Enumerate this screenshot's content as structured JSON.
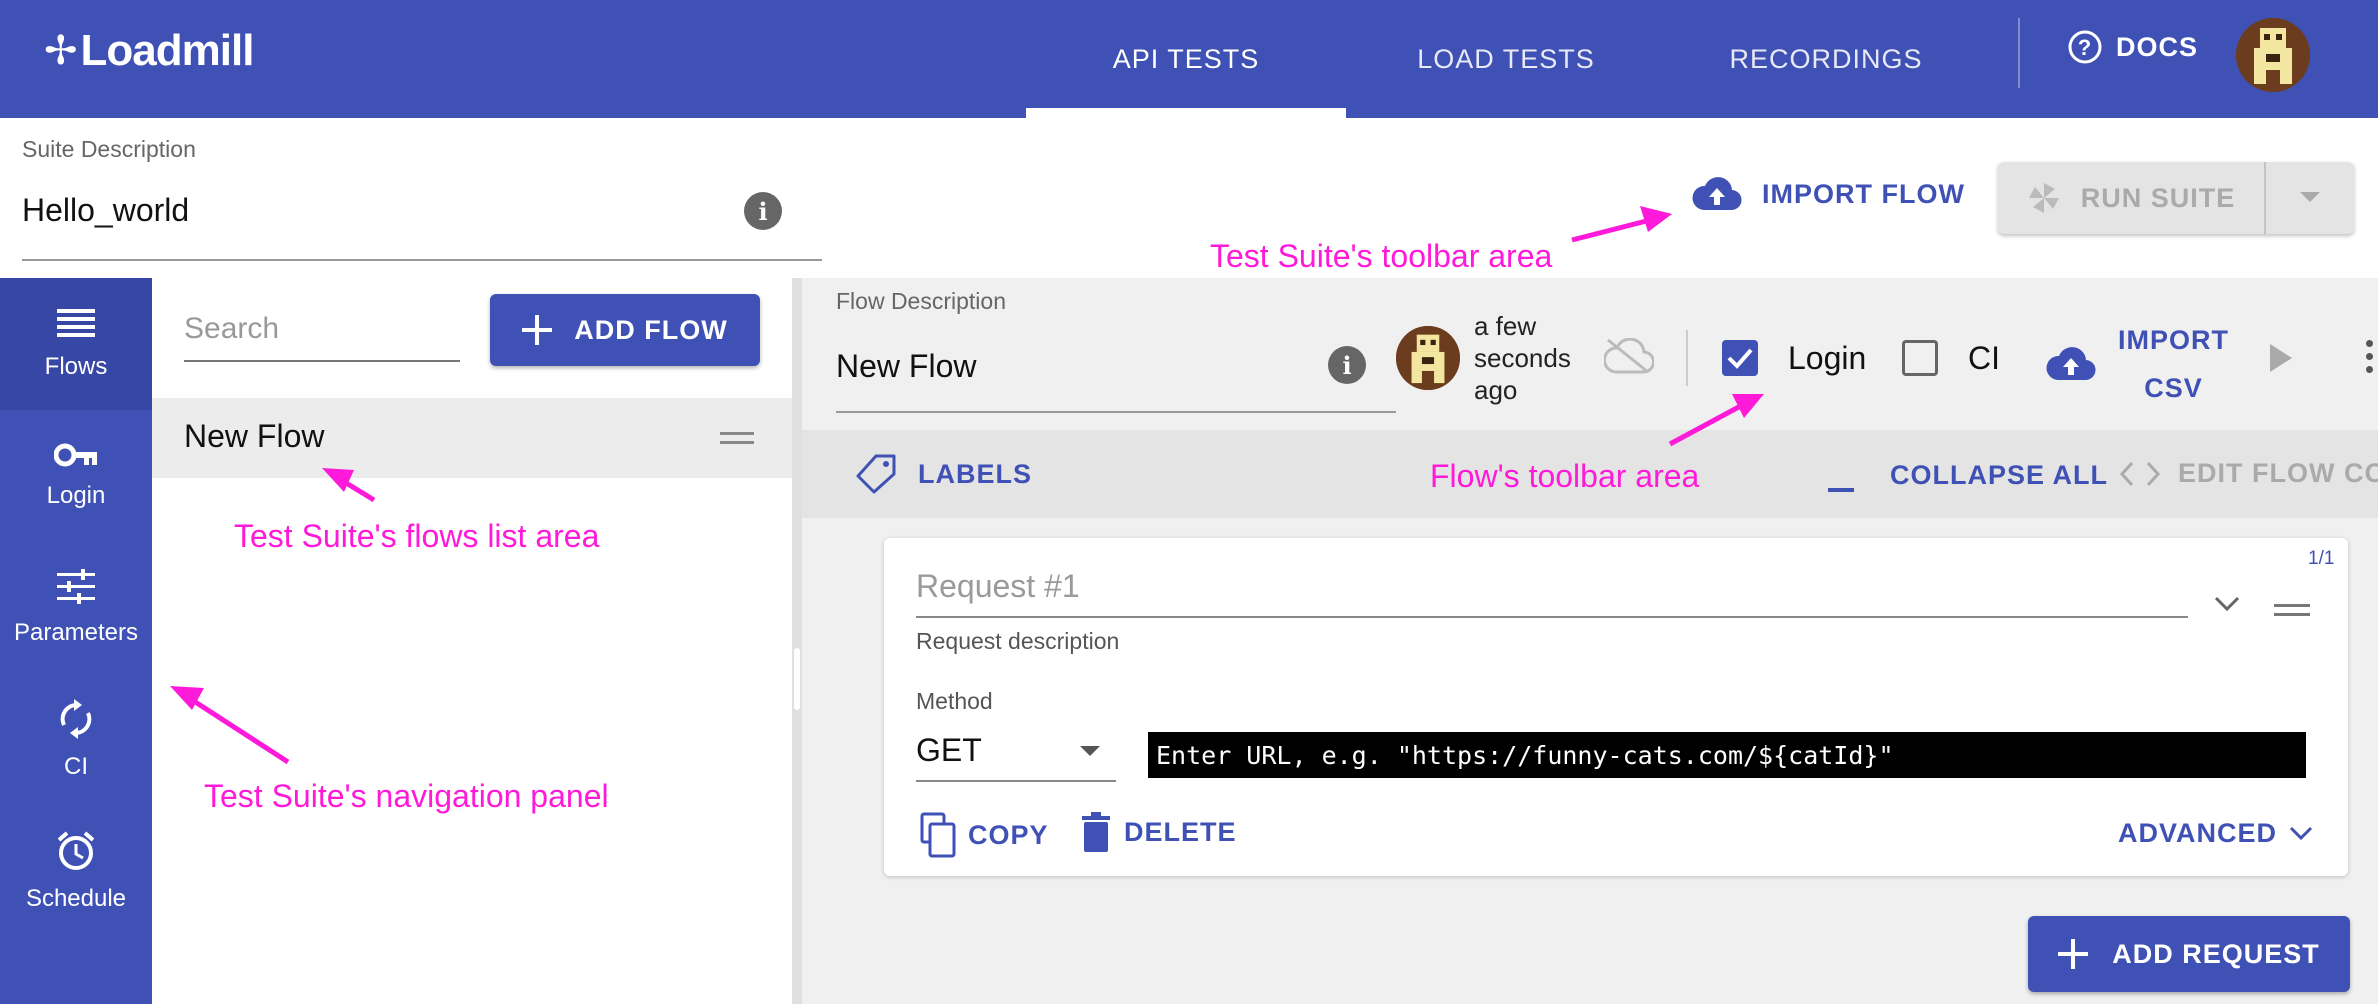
{
  "header": {
    "logo_text": "Loadmill",
    "tabs": [
      {
        "label": "API TESTS",
        "active": true
      },
      {
        "label": "LOAD TESTS",
        "active": false
      },
      {
        "label": "RECORDINGS",
        "active": false
      }
    ],
    "docs_label": "DOCS",
    "brand_color": "#3f51b5"
  },
  "suite": {
    "description_label": "Suite Description",
    "description_value": "Hello_world",
    "import_flow_label": "IMPORT FLOW",
    "run_suite_label": "RUN SUITE"
  },
  "sidebar": {
    "items": [
      {
        "label": "Flows",
        "icon": "list-icon",
        "active": true
      },
      {
        "label": "Login",
        "icon": "key-icon",
        "active": false
      },
      {
        "label": "Parameters",
        "icon": "sliders-icon",
        "active": false
      },
      {
        "label": "CI",
        "icon": "sync-icon",
        "active": false
      },
      {
        "label": "Schedule",
        "icon": "alarm-clock-icon",
        "active": false
      }
    ]
  },
  "flows_list": {
    "search_placeholder": "Search",
    "add_flow_label": "ADD FLOW",
    "items": [
      {
        "label": "New Flow",
        "selected": true
      }
    ]
  },
  "flow": {
    "description_label": "Flow Description",
    "description_value": "New Flow",
    "updated_ago": "a few seconds ago",
    "login_label": "Login",
    "login_checked": true,
    "ci_label": "CI",
    "ci_checked": false,
    "import_csv_line1": "IMPORT",
    "import_csv_line2": "CSV",
    "labels_label": "LABELS",
    "collapse_all_label": "COLLAPSE ALL",
    "edit_flow_code_label": "EDIT FLOW CODE",
    "add_request_label": "ADD REQUEST"
  },
  "request": {
    "counter": "1/1",
    "name_placeholder": "Request #1",
    "description_label": "Request description",
    "method_label": "Method",
    "method_value": "GET",
    "url_placeholder": "Enter URL, e.g. \"https://funny-cats.com/${catId}\"",
    "copy_label": "COPY",
    "delete_label": "DELETE",
    "advanced_label": "ADVANCED"
  },
  "annotations": {
    "suite_toolbar": "Test Suite's toolbar area",
    "flow_toolbar": "Flow's toolbar area",
    "flows_list": "Test Suite's flows list area",
    "navigation": "Test Suite's navigation panel",
    "color": "#ff1ad9"
  }
}
